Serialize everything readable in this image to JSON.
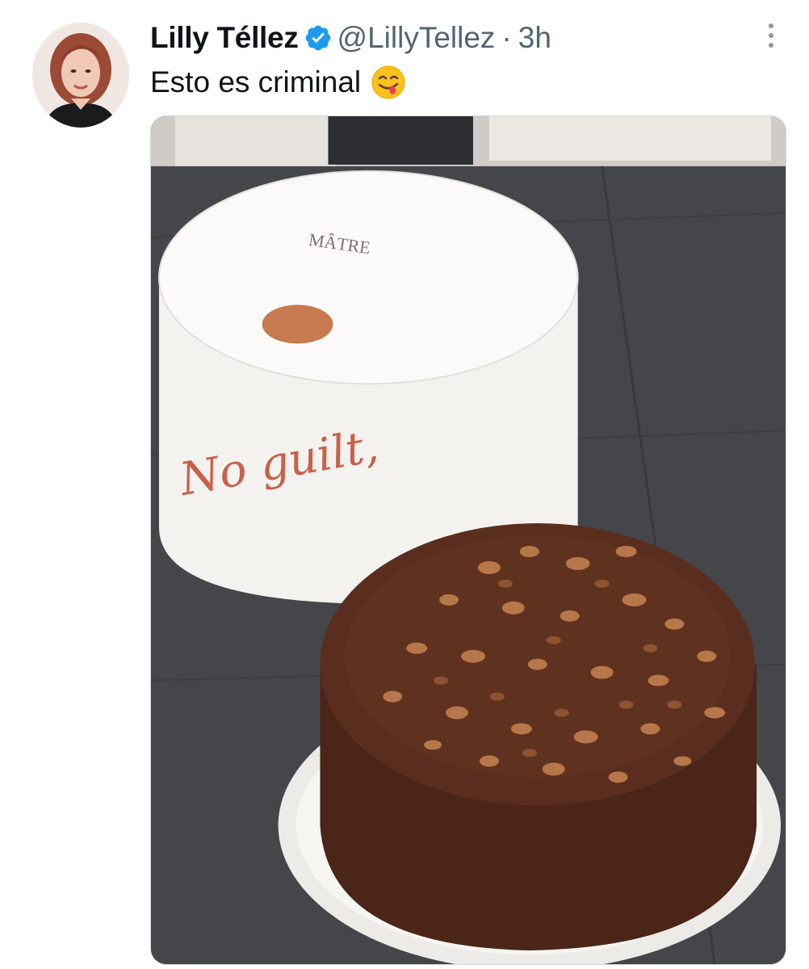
{
  "tweet": {
    "author": {
      "display_name": "Lilly Téllez",
      "handle": "@LillyTellez",
      "verified": true,
      "avatar_icon": "profile-photo"
    },
    "separator": "·",
    "time": "3h",
    "text": "Esto es criminal",
    "emoji": "face-savoring-food-emoji",
    "menu_icon": "more-vertical-icon",
    "media": {
      "type": "photo",
      "box_lettering": [
        "MÂTRE",
        "No guilt,"
      ]
    }
  },
  "colors": {
    "text_primary": "#0f1419",
    "text_secondary": "#536471",
    "verified_blue": "#1d9bf0",
    "border": "#cfd9de"
  }
}
